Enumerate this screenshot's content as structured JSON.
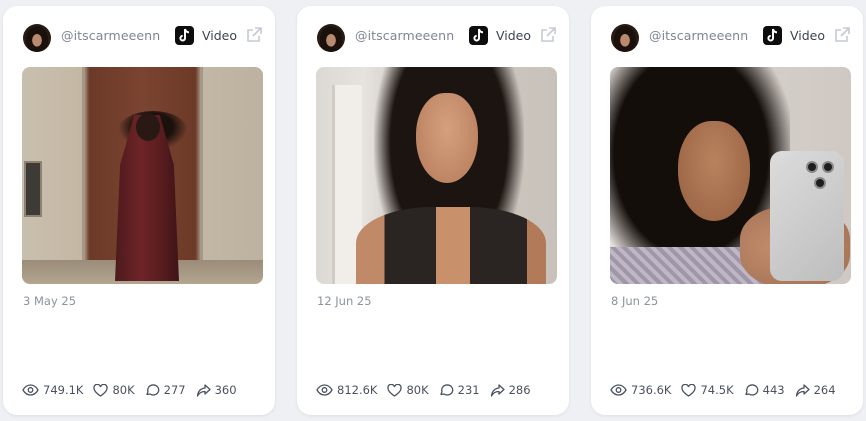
{
  "posts": [
    {
      "username": "@itscarmeeenn",
      "type": "Video",
      "date": "3 May 25",
      "views": "749.1K",
      "likes": "80K",
      "comments": "277",
      "shares": "360"
    },
    {
      "username": "@itscarmeeenn",
      "type": "Video",
      "date": "12 Jun 25",
      "views": "812.6K",
      "likes": "80K",
      "comments": "231",
      "shares": "286"
    },
    {
      "username": "@itscarmeeenn",
      "type": "Video",
      "date": "8 Jun 25",
      "views": "736.6K",
      "likes": "74.5K",
      "comments": "443",
      "shares": "264"
    }
  ],
  "icons": {
    "platform": "tiktok-icon",
    "open": "external-link-icon",
    "views": "eye-icon",
    "likes": "heart-icon",
    "comments": "comment-icon",
    "shares": "share-icon"
  },
  "colors": {
    "background": "#eef0f4",
    "card": "#ffffff",
    "muted_text": "#7d8694",
    "stat_text": "#4a5260"
  }
}
